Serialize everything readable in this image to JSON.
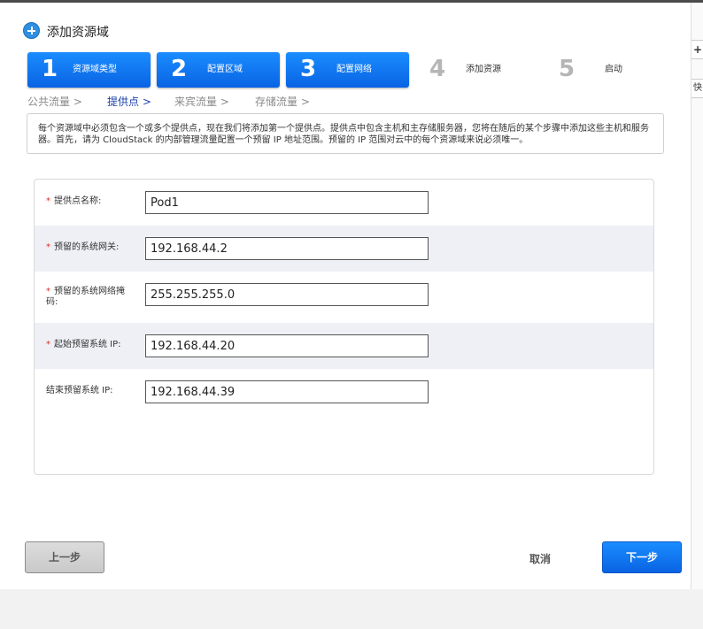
{
  "dialog": {
    "title": "添加资源域"
  },
  "steps": [
    {
      "number": "1",
      "label": "资源域类型",
      "state": "completed"
    },
    {
      "number": "2",
      "label": "配置区域",
      "state": "completed"
    },
    {
      "number": "3",
      "label": "配置网络",
      "state": "active"
    },
    {
      "number": "4",
      "label": "添加资源",
      "state": "pending"
    },
    {
      "number": "5",
      "label": "启动",
      "state": "pending"
    }
  ],
  "substeps": [
    {
      "label": "公共流量 >",
      "current": false
    },
    {
      "label": "提供点 >",
      "current": true
    },
    {
      "label": "来宾流量 >",
      "current": false
    },
    {
      "label": "存储流量 >",
      "current": false
    }
  ],
  "info_text": "每个资源域中必须包含一个或多个提供点，现在我们将添加第一个提供点。提供点中包含主机和主存储服务器，您将在随后的某个步骤中添加这些主机和服务器。首先，请为 CloudStack 的内部管理流量配置一个预留 IP 地址范围。预留的 IP 范围对云中的每个资源域来说必须唯一。",
  "form": {
    "fields": [
      {
        "label": "提供点名称:",
        "required": true,
        "value": "Pod1"
      },
      {
        "label": "预留的系统网关:",
        "required": true,
        "value": "192.168.44.2"
      },
      {
        "label": "预留的系统网络掩码:",
        "required": true,
        "value": "255.255.255.0"
      },
      {
        "label": "起始预留系统 IP:",
        "required": true,
        "value": "192.168.44.20"
      },
      {
        "label": "结束预留系统 IP:",
        "required": false,
        "value": "192.168.44.39"
      }
    ]
  },
  "buttons": {
    "prev": "上一步",
    "cancel": "取消",
    "next": "下一步"
  },
  "side_edge": {
    "plus_glyph": "+",
    "fragment": "快"
  },
  "colors": {
    "accent": "#0a63e3",
    "required": "#d93025",
    "current_substep": "#1a3fa8"
  }
}
